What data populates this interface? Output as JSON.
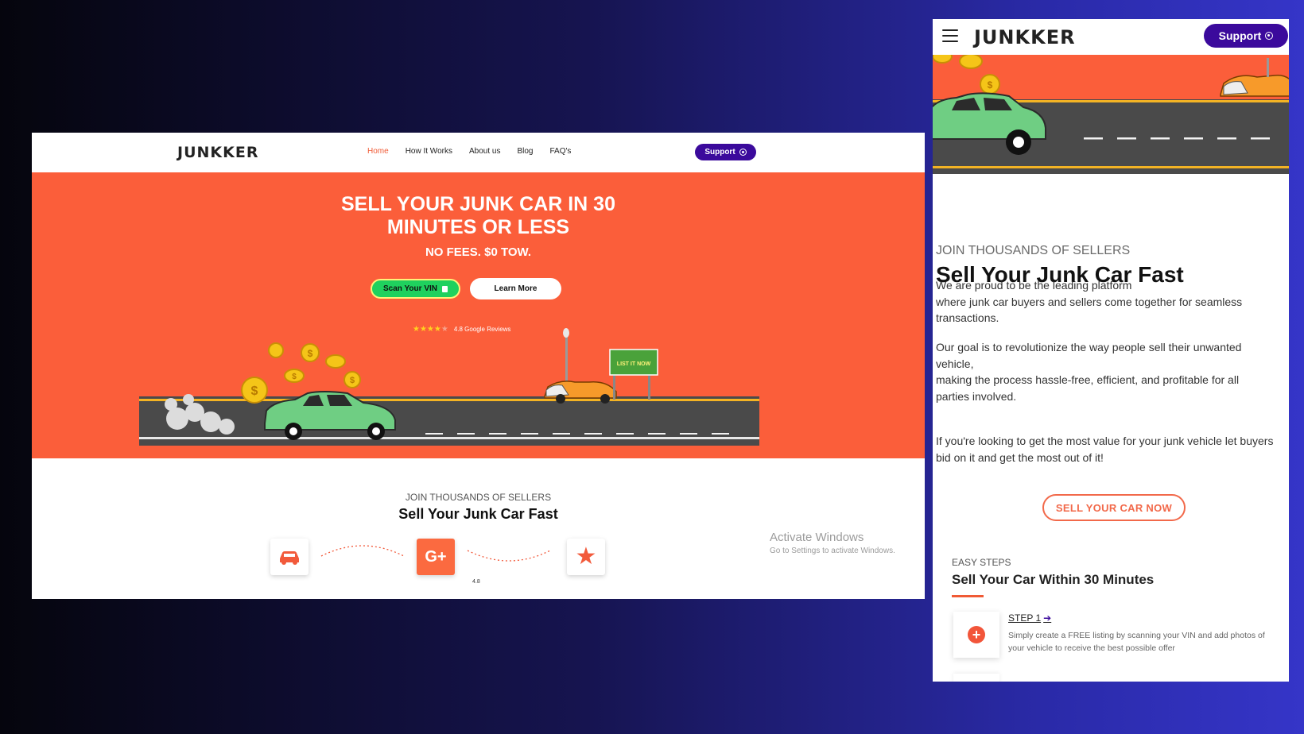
{
  "desktop": {
    "logo": "JUNKKER",
    "nav": [
      "Home",
      "How It Works",
      "About us",
      "Blog",
      "FAQ's"
    ],
    "support_label": "Support",
    "hero": {
      "title_line1": "SELL YOUR JUNK CAR IN 30",
      "title_line2": "MINUTES OR LESS",
      "subtitle": "NO FEES. $0 TOW.",
      "scan_vin_label": "Scan Your VIN",
      "learn_more_label": "Learn More",
      "reviews_text": "4.8 Google Reviews",
      "rating_stars": 4,
      "sign_text": "LIST IT NOW"
    },
    "section": {
      "subtitle": "JOIN THOUSANDS OF SELLERS",
      "title": "Sell Your Junk Car Fast",
      "feature_icons": [
        "car-icon",
        "google-plus-icon",
        "star-icon"
      ],
      "google_badge": "G+",
      "partial_text": "4.8"
    },
    "activate_windows": {
      "title": "Activate Windows",
      "subtitle": "Go to Settings to activate Windows."
    }
  },
  "mobile": {
    "logo": "JUNKKER",
    "support_label": "Support",
    "subtitle": "JOIN THOUSANDS OF SELLERS",
    "title": "Sell Your Junk Car Fast",
    "paragraph1_line1": "We are proud to be the leading platform",
    "paragraph1_line2": "where junk car buyers and sellers come together for seamless transactions.",
    "paragraph2_line1": "Our goal is to revolutionize the way people sell their unwanted vehicle,",
    "paragraph2_line2": "making the process hassle-free, efficient, and profitable for all parties involved.",
    "paragraph3": "If you're looking to get the most value for your junk vehicle let buyers bid on it and get the most out of it!",
    "cta_label": "SELL YOUR CAR NOW",
    "easy_steps_label": "EASY STEPS",
    "steps_title": "Sell Your Car Within 30 Minutes",
    "step1_label": "STEP 1",
    "step1_desc": "Simply create a FREE listing by scanning your VIN and add photos of your vehicle to receive the best possible offer"
  },
  "colors": {
    "hero_orange": "#fb5e3a",
    "support_purple": "#3b0a9c",
    "vin_green": "#1fd15e",
    "accent_orange": "#f2694a"
  }
}
